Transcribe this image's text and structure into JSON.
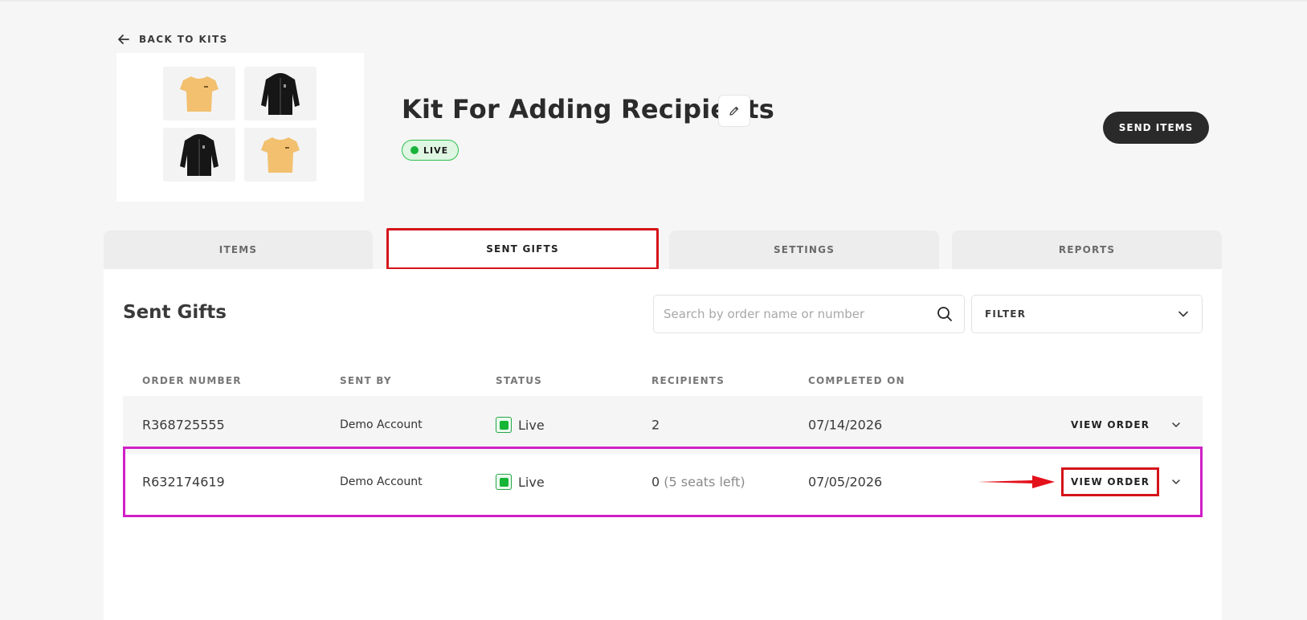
{
  "nav": {
    "back_label": "BACK TO KITS"
  },
  "kit": {
    "title": "Kit For Adding Recipients",
    "status": "LIVE",
    "thumbnails": [
      "tshirt-icon",
      "hoodie-icon",
      "hoodie-icon",
      "tshirt-icon"
    ]
  },
  "header": {
    "send_items_label": "SEND ITEMS"
  },
  "tabs": [
    {
      "label": "ITEMS"
    },
    {
      "label": "SENT GIFTS"
    },
    {
      "label": "SETTINGS"
    },
    {
      "label": "REPORTS"
    }
  ],
  "sent_gifts": {
    "title": "Sent Gifts",
    "search_placeholder": "Search by order name or number",
    "filter_label": "FILTER",
    "columns": [
      "ORDER NUMBER",
      "SENT BY",
      "STATUS",
      "RECIPIENTS",
      "COMPLETED ON"
    ],
    "rows": [
      {
        "order_number": "R368725555",
        "sent_by": "Demo Account",
        "status": "Live",
        "recipients": "2",
        "seats": "",
        "completed_on": "07/14/2026",
        "action": "VIEW ORDER"
      },
      {
        "order_number": "R632174619",
        "sent_by": "Demo Account",
        "status": "Live",
        "recipients": "0",
        "seats": "(5 seats left)",
        "completed_on": "07/05/2026",
        "action": "VIEW ORDER"
      }
    ]
  },
  "colors": {
    "highlight_red": "#d4141a",
    "highlight_magenta": "#d11fc7",
    "live_green": "#15b536",
    "button_dark": "#2a2a2a"
  }
}
